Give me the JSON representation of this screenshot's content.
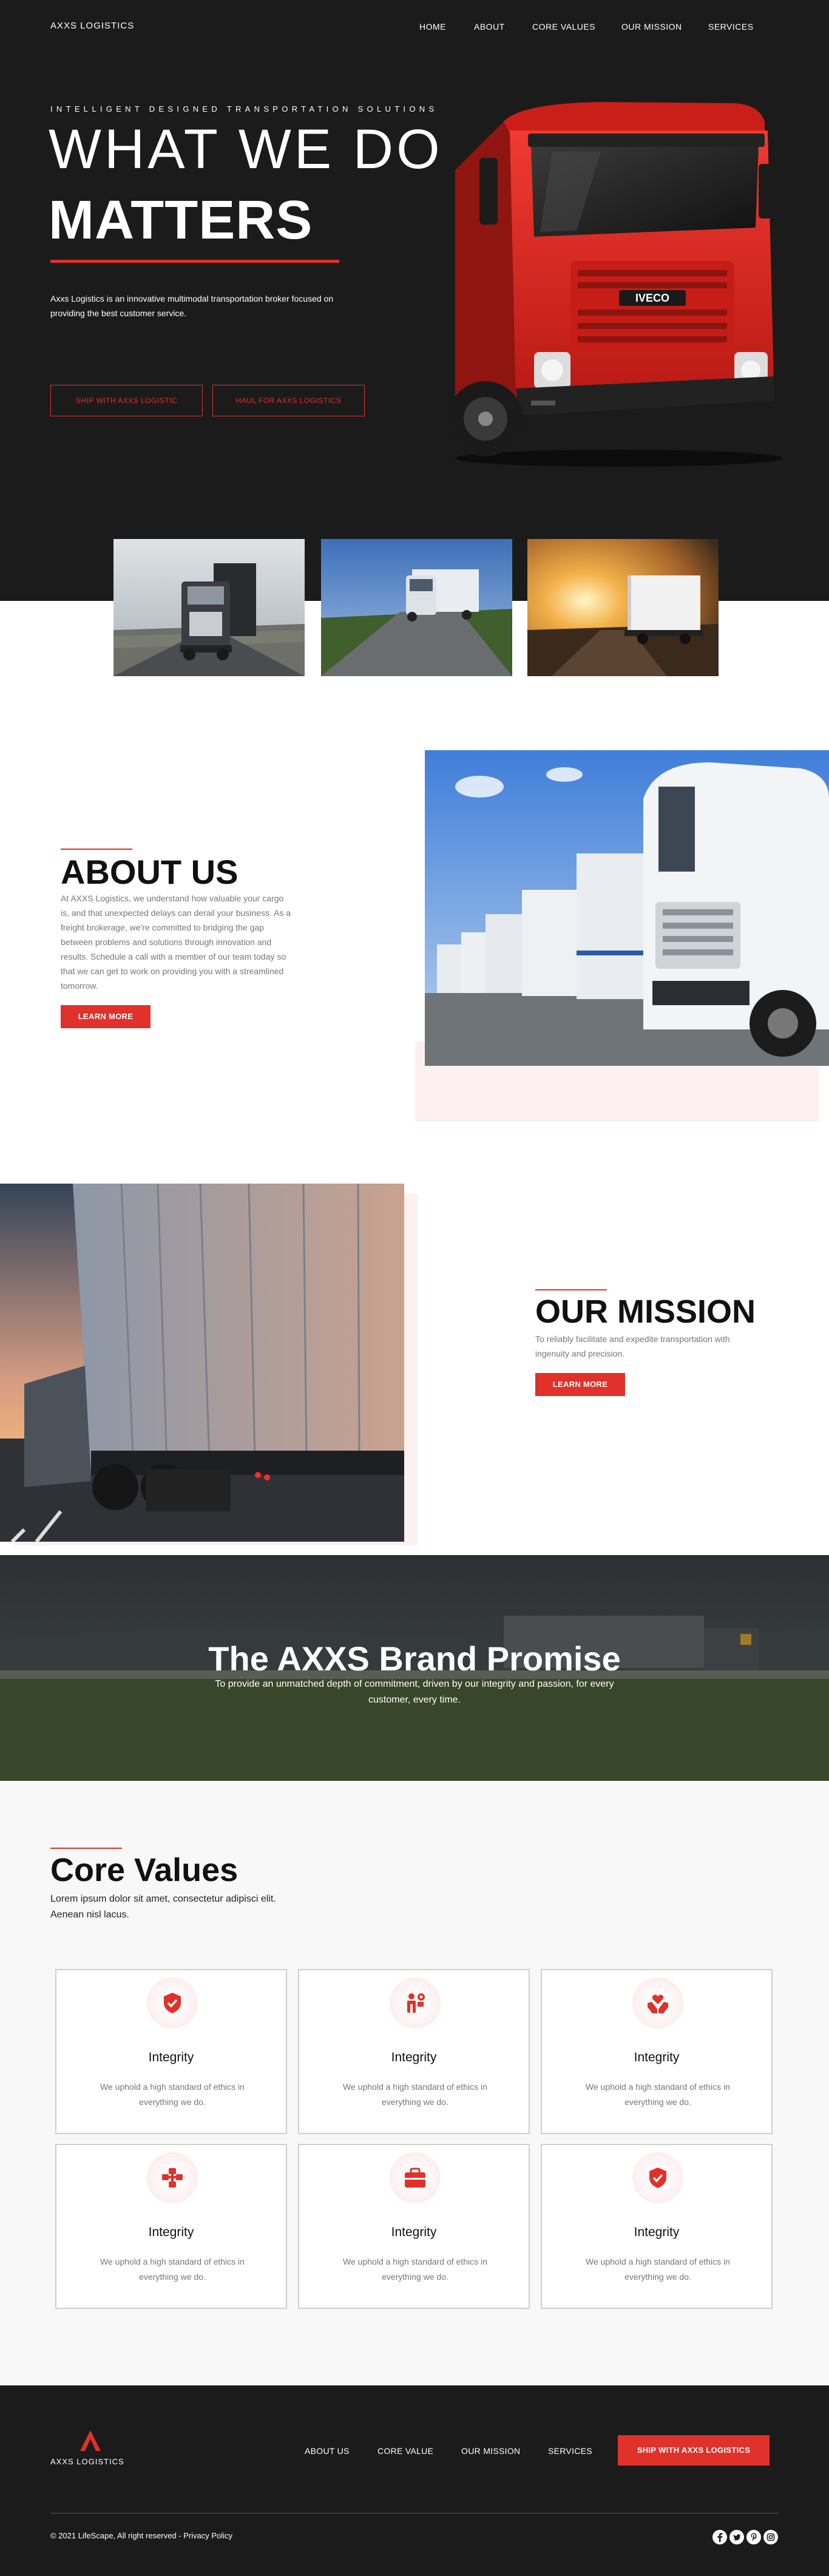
{
  "header": {
    "brand": "AXXS LOGISTICS",
    "nav": [
      "HOME",
      "ABOUT",
      "CORE VALUES",
      "OUR MISSION",
      "SERVICES"
    ]
  },
  "hero": {
    "tagline": "INTELLIGENT DESIGNED TRANSPORTATION SOLUTIONS",
    "title_line1": "WHAT WE DO",
    "title_line2": "MATTERS",
    "description": "Axxs Logistics is an innovative multimodal transportation broker focused on providing the best customer service.",
    "btn_ship": "SHIP WITH AXXS LOGISTIC",
    "btn_haul": "HAUL FOR AXXS LOGISTICS",
    "truck_badge": "IVECO"
  },
  "about": {
    "title": "ABOUT US",
    "text": "At AXXS Logistics, we understand how valuable your cargo is, and that unexpected delays can derail your business. As a freight brokerage, we're committed to bridging the gap between problems and solutions through innovation and results. Schedule a call with a member of our team today so that we can get to work on providing you with a streamlined tomorrow.",
    "button": "LEARN MORE"
  },
  "mission": {
    "title": "OUR MISSION",
    "text": "To reliably facilitate and expedite transportation with ingenuity and precision.",
    "button": "LEARN MORE"
  },
  "promise": {
    "title": "The AXXS Brand Promise",
    "text": "To provide an unmatched depth of commitment, driven by our integrity and passion, for every customer, every time."
  },
  "core_values": {
    "title": "Core Values",
    "subtitle": "Lorem ipsum dolor sit amet, consectetur adipisci elit. Aenean nisl lacus.",
    "cards": [
      {
        "title": "Integrity",
        "text": "We uphold a high standard of ethics in everything we do.",
        "icon": "shield-check-icon"
      },
      {
        "title": "Integrity",
        "text": "We uphold a high standard of ethics in everything we do.",
        "icon": "person-gear-icon"
      },
      {
        "title": "Integrity",
        "text": "We uphold a high standard of ethics in everything we do.",
        "icon": "hands-heart-icon"
      },
      {
        "title": "Integrity",
        "text": "We uphold a high standard of ethics in everything we do.",
        "icon": "network-icon"
      },
      {
        "title": "Integrity",
        "text": "We uphold a high standard of ethics in everything we do.",
        "icon": "briefcase-icon"
      },
      {
        "title": "Integrity",
        "text": "We uphold a high standard of ethics in everything we do.",
        "icon": "shield-check-icon"
      }
    ]
  },
  "footer": {
    "brand": "AXXS LOGISTICS",
    "nav": [
      "ABOUT US",
      "CORE VALUE",
      "OUR MISSION",
      "SERVICES"
    ],
    "button": "SHIP WITH AXXS LOGISTICS",
    "copyright": "© 2021 LifeScape, All right reserved - Privacy Policy",
    "social": [
      "facebook-icon",
      "twitter-icon",
      "pinterest-icon",
      "instagram-icon"
    ]
  },
  "colors": {
    "accent": "#e0312a",
    "dark": "#1b1b1b",
    "light_pink": "#fdf0f0"
  }
}
